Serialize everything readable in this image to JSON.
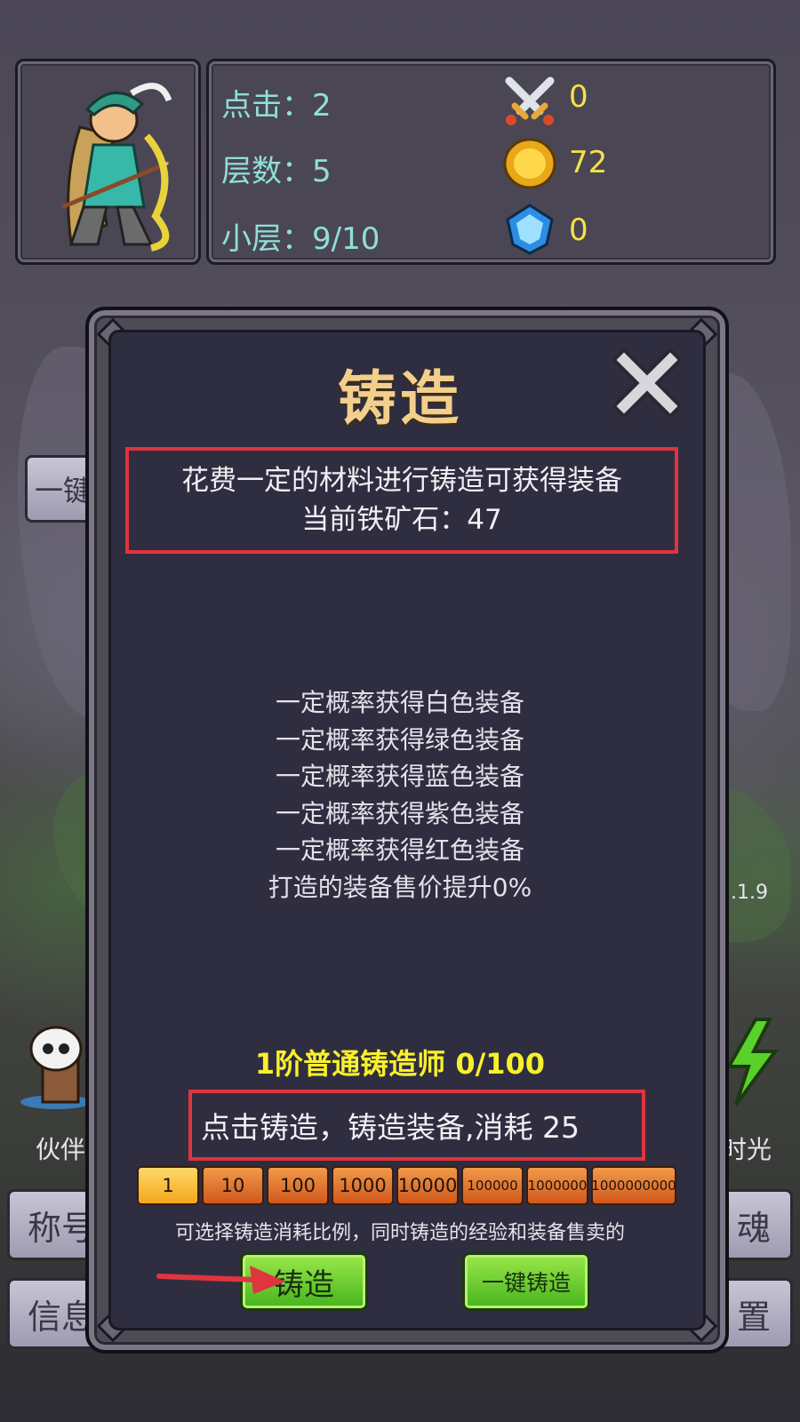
{
  "hud": {
    "click_label": "点击：2",
    "floor_label": "层数：5",
    "sublevel_label": "小层：9/10",
    "resources": [
      {
        "icon": "crossed-swords-icon",
        "value": "0"
      },
      {
        "icon": "gold-coin-icon",
        "value": "72"
      },
      {
        "icon": "blue-gem-icon",
        "value": "0"
      }
    ]
  },
  "background": {
    "left_top_btn": "一键",
    "left_label": "伙伴",
    "left_btn_1": "称号",
    "left_btn_2": "信息",
    "right_label": "时光",
    "right_btn_1": "魂",
    "right_btn_2": "置",
    "version_fragment": ".1.9"
  },
  "dialog": {
    "title": "铸造",
    "description": "花费一定的材料进行铸造可获得装备",
    "current_ore": "当前铁矿石：47",
    "probabilities": [
      "一定概率获得白色装备",
      "一定概率获得绿色装备",
      "一定概率获得蓝色装备",
      "一定概率获得紫色装备",
      "一定概率获得红色装备",
      "打造的装备售价提升0%"
    ],
    "rank": "1阶普通铸造师 0/100",
    "cost_text": "点击铸造，铸造装备,消耗 25",
    "ratios": [
      "1",
      "10",
      "100",
      "1000",
      "10000",
      "100000",
      "1000000",
      "1000000000"
    ],
    "selected_ratio": "1",
    "hint": "可选择铸造消耗比例，同时铸造的经验和装备售卖的",
    "forge_button": "铸造",
    "one_click_button": "一键铸造"
  },
  "colors": {
    "title": "#f3cf8c",
    "stat_text": "#8fe0d8",
    "resource_text": "#f4e24a",
    "highlight_box": "#e0343e",
    "rank_text": "#f7f02c",
    "button_green": "#45b41c",
    "ratio_orange": "#d0581c"
  }
}
